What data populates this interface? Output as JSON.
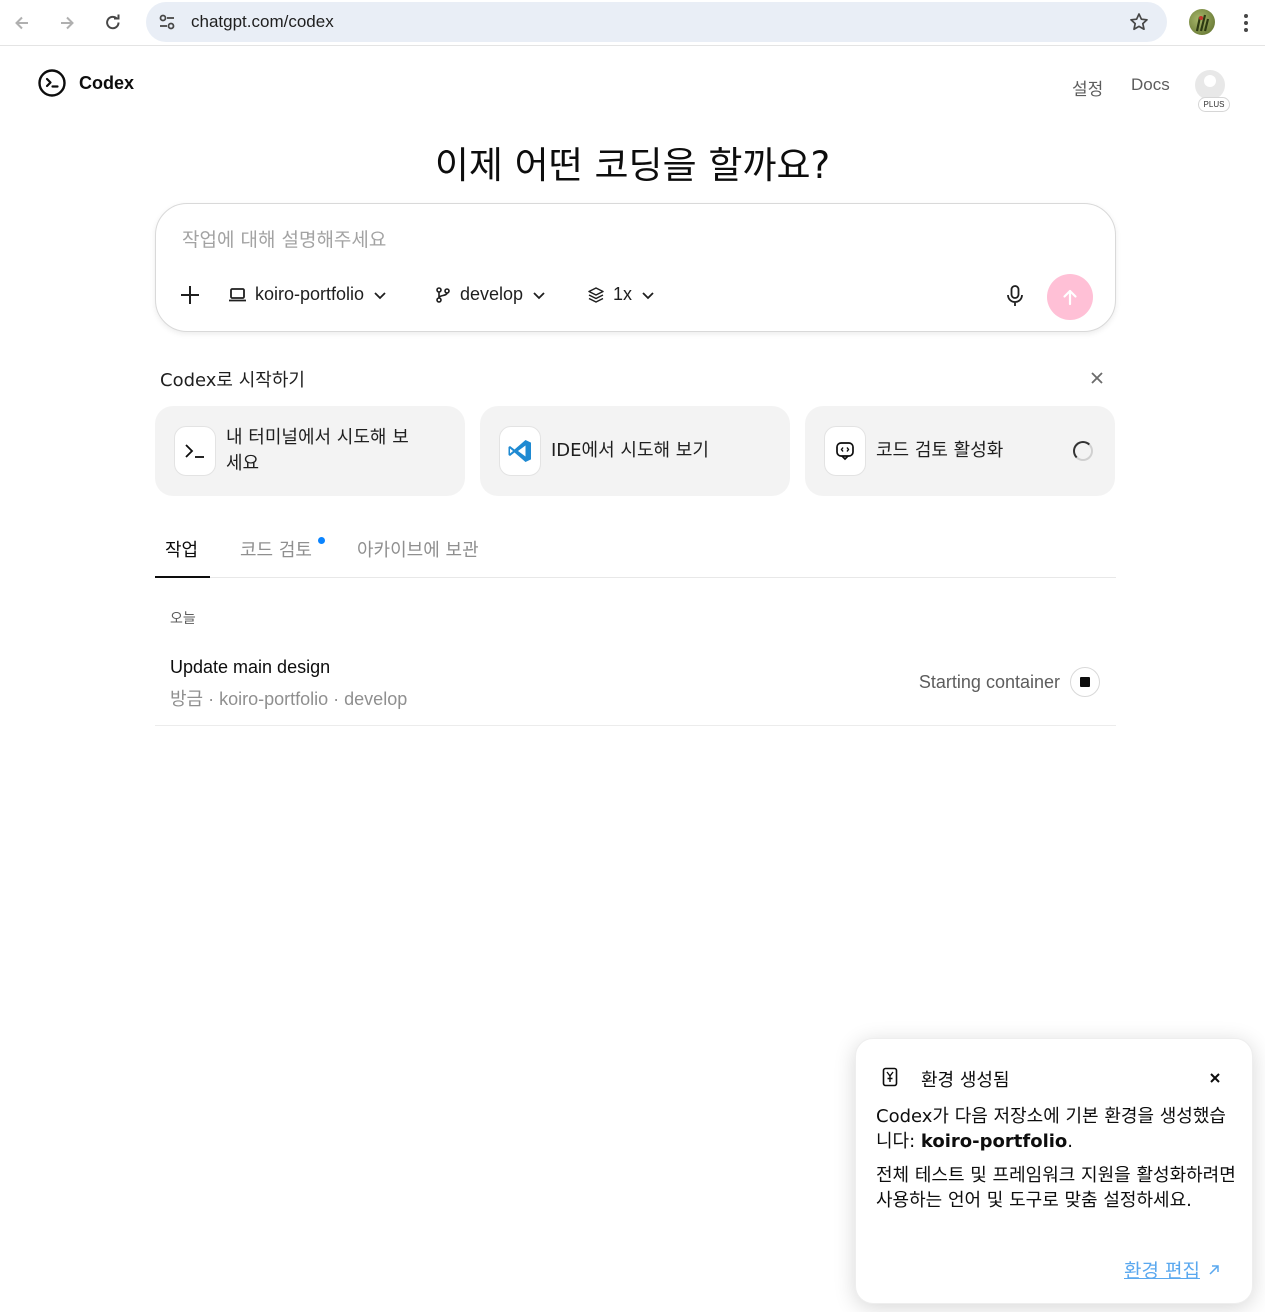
{
  "browser": {
    "url": "chatgpt.com/codex"
  },
  "header": {
    "app_name": "Codex",
    "settings_label": "설정",
    "docs_label": "Docs",
    "plan_badge": "PLUS"
  },
  "main": {
    "title": "이제 어떤 코딩을 할까요?",
    "composer": {
      "placeholder": "작업에 대해 설명해주세요",
      "repo": "koiro-portfolio",
      "branch": "develop",
      "versions": "1x"
    },
    "get_started": {
      "heading": "Codex로 시작하기",
      "cards": [
        {
          "label": "내 터미널에서 시도해 보세요",
          "icon": "terminal-icon"
        },
        {
          "label": "IDE에서 시도해 보기",
          "icon": "vscode-icon"
        },
        {
          "label": "코드 검토 활성화",
          "icon": "code-review-icon"
        }
      ]
    },
    "tabs": [
      {
        "label": "작업",
        "active": true
      },
      {
        "label": "코드 검토",
        "has_dot": true
      },
      {
        "label": "아카이브에 보관"
      }
    ],
    "task_group": "오늘",
    "tasks": [
      {
        "title": "Update main design",
        "meta": "방금 · koiro-portfolio · develop",
        "status": "Starting container"
      }
    ]
  },
  "toast": {
    "heading": "환경 생성됨",
    "text1_prefix": "Codex가 다음 저장소에 기본 환경을 생성했습니다: ",
    "text1_repo": "koiro-portfolio",
    "text1_suffix": ".",
    "text2": "전체 테스트 및 프레임워크 지원을 활성화하려면 사용하는 언어 및 도구로 맞춤 설정하세요.",
    "edit_link": "환경 편집"
  },
  "colors": {
    "send_button": "#ffc0d6",
    "tab_dot": "#0a84ff",
    "link": "#5aa8ef",
    "address_bar": "#e9eef6"
  }
}
